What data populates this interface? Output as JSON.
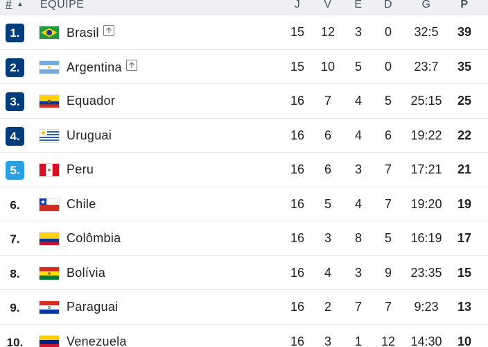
{
  "header": {
    "rank_label": "#",
    "sort_arrow": "▲",
    "team_label": "EQUIPE",
    "cols": [
      "J",
      "V",
      "E",
      "D",
      "G",
      "P"
    ]
  },
  "colors": {
    "qualified": "#003d7a",
    "playoff": "#2aa0e2"
  },
  "rows": [
    {
      "rank": "1.",
      "zone": "qualified",
      "flag": "brazil",
      "team": "Brasil",
      "up": true,
      "j": "15",
      "v": "12",
      "e": "3",
      "d": "0",
      "g": "32:5",
      "p": "39"
    },
    {
      "rank": "2.",
      "zone": "qualified",
      "flag": "argentina",
      "team": "Argentina",
      "up": true,
      "j": "15",
      "v": "10",
      "e": "5",
      "d": "0",
      "g": "23:7",
      "p": "35"
    },
    {
      "rank": "3.",
      "zone": "qualified",
      "flag": "ecuador",
      "team": "Equador",
      "up": false,
      "j": "16",
      "v": "7",
      "e": "4",
      "d": "5",
      "g": "25:15",
      "p": "25"
    },
    {
      "rank": "4.",
      "zone": "qualified",
      "flag": "uruguay",
      "team": "Uruguai",
      "up": false,
      "j": "16",
      "v": "6",
      "e": "4",
      "d": "6",
      "g": "19:22",
      "p": "22"
    },
    {
      "rank": "5.",
      "zone": "playoff",
      "flag": "peru",
      "team": "Peru",
      "up": false,
      "j": "16",
      "v": "6",
      "e": "3",
      "d": "7",
      "g": "17:21",
      "p": "21"
    },
    {
      "rank": "6.",
      "zone": "none",
      "flag": "chile",
      "team": "Chile",
      "up": false,
      "j": "16",
      "v": "5",
      "e": "4",
      "d": "7",
      "g": "19:20",
      "p": "19"
    },
    {
      "rank": "7.",
      "zone": "none",
      "flag": "colombia",
      "team": "Colômbia",
      "up": false,
      "j": "16",
      "v": "3",
      "e": "8",
      "d": "5",
      "g": "16:19",
      "p": "17"
    },
    {
      "rank": "8.",
      "zone": "none",
      "flag": "bolivia",
      "team": "Bolívia",
      "up": false,
      "j": "16",
      "v": "4",
      "e": "3",
      "d": "9",
      "g": "23:35",
      "p": "15"
    },
    {
      "rank": "9.",
      "zone": "none",
      "flag": "paraguay",
      "team": "Paraguai",
      "up": false,
      "j": "16",
      "v": "2",
      "e": "7",
      "d": "7",
      "g": "9:23",
      "p": "13"
    },
    {
      "rank": "10.",
      "zone": "none",
      "flag": "venezuela",
      "team": "Venezuela",
      "up": false,
      "j": "16",
      "v": "3",
      "e": "1",
      "d": "12",
      "g": "14:30",
      "p": "10"
    }
  ]
}
